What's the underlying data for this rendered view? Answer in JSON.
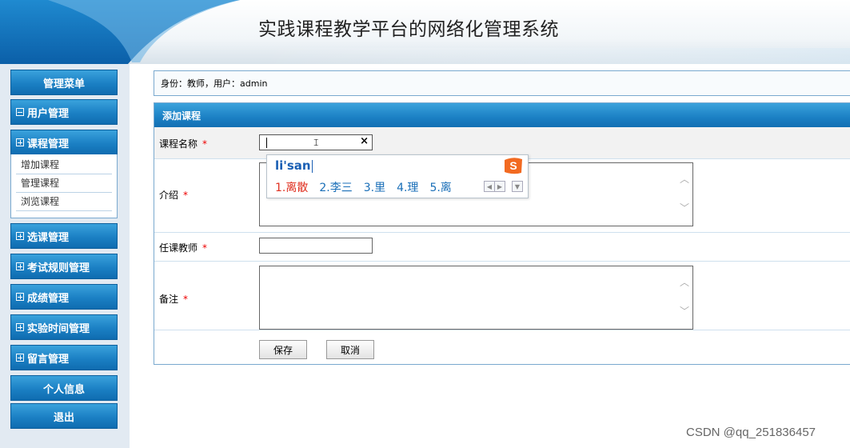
{
  "header": {
    "title": "实践课程教学平台的网络化管理系统"
  },
  "sidebar": {
    "menu_title": "管理菜单",
    "groups": [
      {
        "label": "用户管理",
        "state": "expanded-minus"
      },
      {
        "label": "课程管理",
        "state": "expanded-plus"
      },
      {
        "label": "选课管理"
      },
      {
        "label": "考试规则管理"
      },
      {
        "label": "成绩管理"
      },
      {
        "label": "实验时间管理"
      },
      {
        "label": "留言管理"
      }
    ],
    "course_sub": [
      "增加课程",
      "管理课程",
      "浏览课程"
    ],
    "profile": "个人信息",
    "logout": "退出"
  },
  "identity": {
    "text": "身份：教师，用户：admin"
  },
  "form": {
    "title": "添加课程",
    "required_mark": "*",
    "course_name_label": "课程名称",
    "course_name_value": "",
    "clear_glyph": "×",
    "intro_label": "介绍",
    "teacher_label": "任课教师",
    "teacher_value": "",
    "notes_label": "备注",
    "save": "保存",
    "cancel": "取消"
  },
  "ime": {
    "composition": "li'san",
    "candidates": [
      "1.离散",
      "2.李三",
      "3.里",
      "4.理",
      "5.离"
    ],
    "logo_letter": "S"
  },
  "watermark": "CSDN @qq_251836457",
  "colors": {
    "accent": "#1b80c4",
    "required": "#ee0000",
    "ime_selected": "#e03020",
    "ime_candidate": "#1a6fb8"
  }
}
